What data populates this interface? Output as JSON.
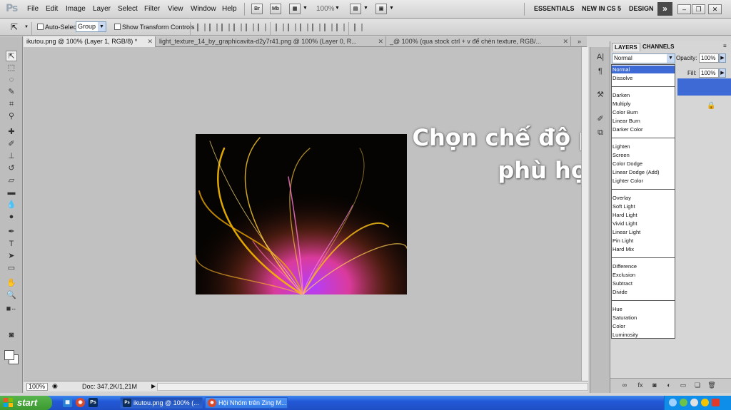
{
  "app": {
    "logo": "Ps"
  },
  "menu": [
    "File",
    "Edit",
    "Image",
    "Layer",
    "Select",
    "Filter",
    "View",
    "Window",
    "Help"
  ],
  "menubar_icons": {
    "bridge": "Br",
    "mini_bridge": "Mb"
  },
  "zoom_level": "100%",
  "workspaces": [
    "ESSENTIALS",
    "NEW IN CS 5",
    "DESIGN"
  ],
  "options": {
    "auto_select_label": "Auto-Select:",
    "auto_select_value": "Group",
    "show_transform_label": "Show Transform Controls"
  },
  "tabs": [
    {
      "label": "ikutou.png @ 100% (Layer 1, RGB/8) *",
      "active": true
    },
    {
      "label": "light_texture_14_by_graphicavita-d2y7r41.png @ 100% (Layer 0, R...",
      "active": false
    },
    {
      "label": "_@ 100% (qua stock ctrl + v để chèn texture, RGB/...",
      "active": false
    }
  ],
  "overlay_text": {
    "line1": "Chọn chế độ pha trộn",
    "line2": "phù hợp"
  },
  "status": {
    "zoom": "100%",
    "doc_info": "Doc: 347,2K/1,21M"
  },
  "layers_panel": {
    "tabs": [
      "LAYERS",
      "CHANNELS"
    ],
    "blend_mode": "Normal",
    "opacity_label": "Opacity:",
    "opacity_value": "100%",
    "fill_label": "Fill:",
    "fill_value": "100%"
  },
  "blend_modes": [
    [
      "Normal",
      "Dissolve"
    ],
    [
      "Darken",
      "Multiply",
      "Color Burn",
      "Linear Burn",
      "Darker Color"
    ],
    [
      "Lighten",
      "Screen",
      "Color Dodge",
      "Linear Dodge (Add)",
      "Lighter Color"
    ],
    [
      "Overlay",
      "Soft Light",
      "Hard Light",
      "Vivid Light",
      "Linear Light",
      "Pin Light",
      "Hard Mix"
    ],
    [
      "Difference",
      "Exclusion",
      "Subtract",
      "Divide"
    ],
    [
      "Hue",
      "Saturation",
      "Color",
      "Luminosity"
    ]
  ],
  "taskbar": {
    "start_label": "start",
    "tasks": [
      {
        "label": "ikutou.png @ 100% (...",
        "icon": "Ps",
        "active": true
      },
      {
        "label": "Hội Nhóm trên Zing M...",
        "icon": "chrome-icon",
        "active": false
      }
    ]
  },
  "colors": {
    "selection": "#3d6ad4",
    "taskbar": "#2358d6",
    "start": "#3c9a31"
  }
}
